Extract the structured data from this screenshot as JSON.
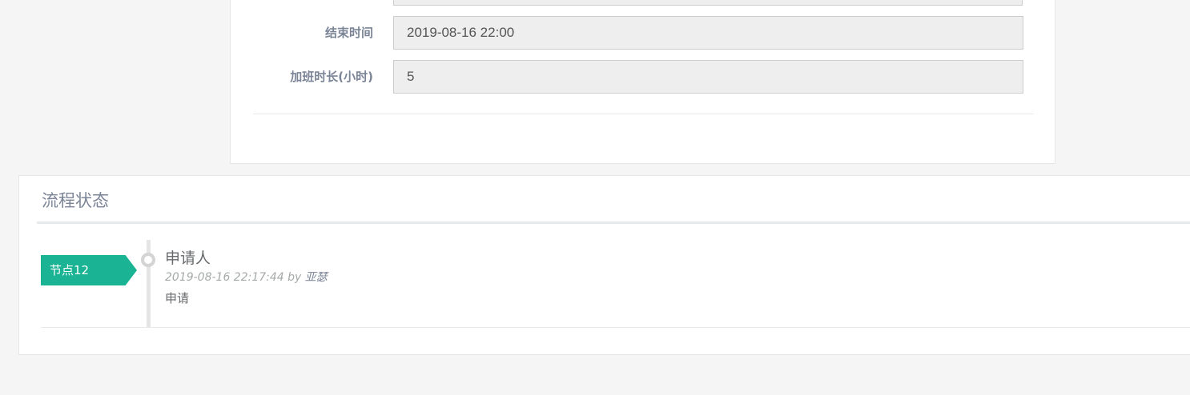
{
  "form": {
    "end_time_label": "结束时间",
    "end_time_value": "2019-08-16 22:00",
    "overtime_label": "加班时长(小时)",
    "overtime_value": "5"
  },
  "workflow": {
    "title": "流程状态",
    "entries": [
      {
        "node": "节点12",
        "title": "申请人",
        "timestamp": "2019-08-16 22:17:44",
        "by_label": "by",
        "author": "亚瑟",
        "action": "申请"
      }
    ]
  },
  "colors": {
    "page_background": "#f5f5f5",
    "node_tag": "#1ab394",
    "label_text": "#7b8597",
    "input_background": "#eeeeee"
  },
  "icons": {
    "timeline_dot": "circle-outline"
  }
}
